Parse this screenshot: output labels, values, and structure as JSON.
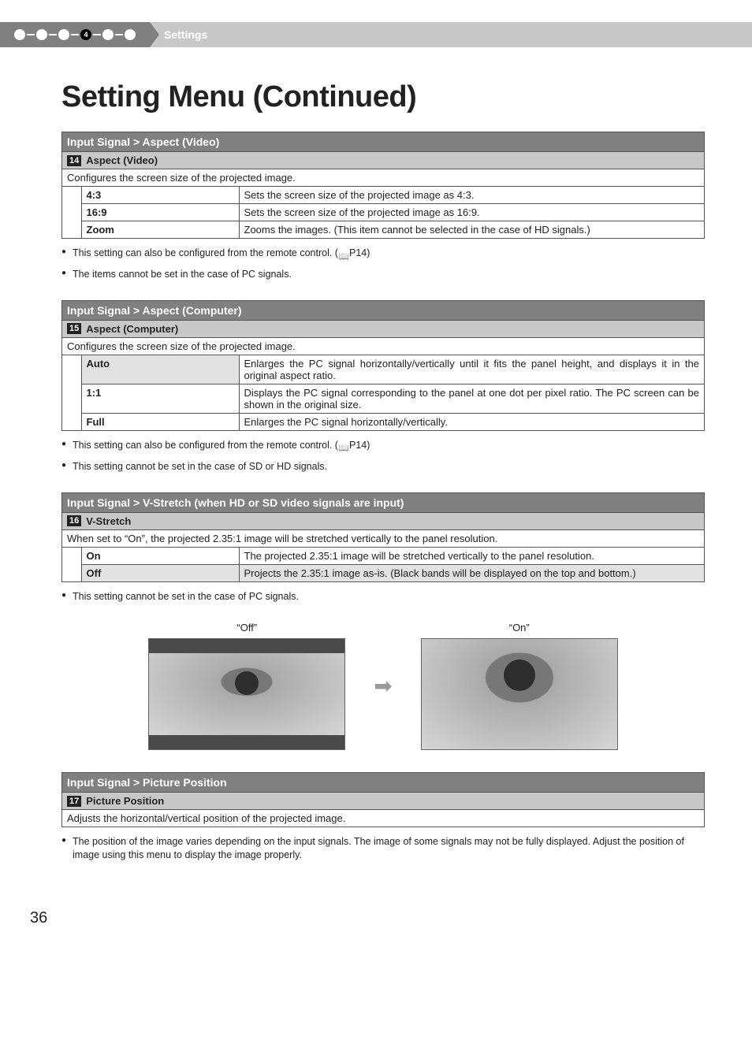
{
  "header": {
    "step_active": "4",
    "section_label": "Settings"
  },
  "title": "Setting Menu (Continued)",
  "sections": {
    "aspect_video": {
      "heading": "Input Signal > Aspect (Video)",
      "badge": "14",
      "subheading": "Aspect (Video)",
      "description": "Configures the screen size of the projected image.",
      "rows": [
        {
          "label": "4:3",
          "value": "Sets the screen size of the projected image as 4:3."
        },
        {
          "label": "16:9",
          "value": "Sets the screen size of the projected image as 16:9."
        },
        {
          "label": "Zoom",
          "value": "Zooms the images. (This item cannot be selected in the case of HD signals.)"
        }
      ],
      "notes": [
        "This setting can also be configured from the remote control. (",
        "The items cannot be set in the case of PC signals."
      ],
      "note_ref": "P14)"
    },
    "aspect_computer": {
      "heading": "Input Signal > Aspect (Computer)",
      "badge": "15",
      "subheading": "Aspect (Computer)",
      "description": "Configures the screen size of the projected image.",
      "rows": [
        {
          "label": "Auto",
          "value": "Enlarges the PC signal horizontally/vertically until it fits the panel height, and displays it in the original aspect ratio."
        },
        {
          "label": "1:1",
          "value": "Displays the PC signal corresponding to the panel at one dot per pixel ratio. The PC screen can be shown in the original size."
        },
        {
          "label": "Full",
          "value": "Enlarges the PC signal horizontally/vertically."
        }
      ],
      "notes": [
        "This setting can also be configured from the remote control. (",
        "This setting cannot be set in the case of SD or HD signals."
      ],
      "note_ref": "P14)"
    },
    "vstretch": {
      "heading": "Input Signal > V-Stretch (when HD or SD video signals are input)",
      "badge": "16",
      "subheading": "V-Stretch",
      "description": "When set to “On”, the projected 2.35:1 image will be stretched vertically to the panel resolution.",
      "rows": [
        {
          "label": "On",
          "value": "The projected 2.35:1 image will be stretched vertically to the panel resolution."
        },
        {
          "label": "Off",
          "value": "Projects the 2.35:1 image as-is. (Black bands will be displayed on the top and bottom.)"
        }
      ],
      "notes": [
        "This setting cannot be set in the case of PC signals."
      ],
      "illus": {
        "off_label": "“Off”",
        "on_label": "“On”"
      }
    },
    "picture_position": {
      "heading": "Input Signal > Picture Position",
      "badge": "17",
      "subheading": "Picture Position",
      "description": "Adjusts the horizontal/vertical position of the projected image.",
      "notes": [
        "The position of the image varies depending on the input signals. The image of some signals may not be fully displayed. Adjust the position of image using this menu to display the image properly."
      ]
    }
  },
  "page_number": "36"
}
